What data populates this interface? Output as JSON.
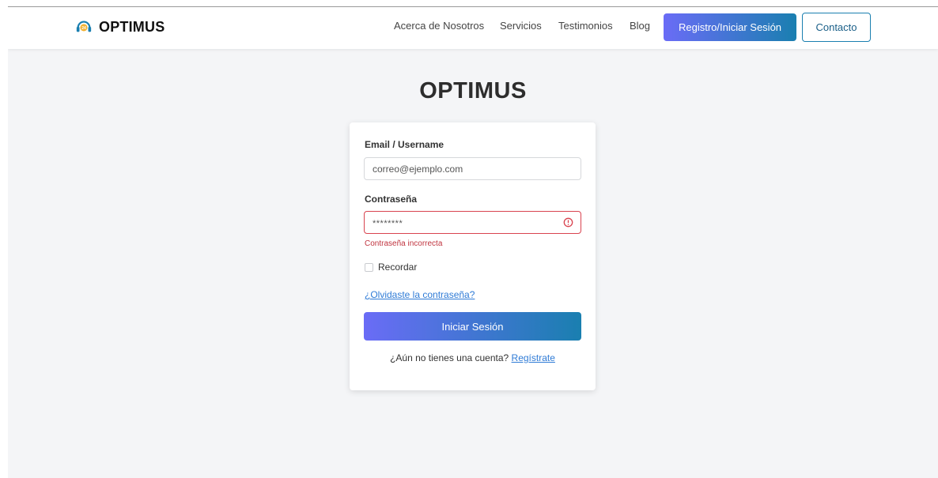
{
  "navbar": {
    "brand": "OPTIMUS",
    "logo_icon": "headset-logo-icon",
    "links": [
      "Acerca de Nosotros",
      "Servicios",
      "Testimonios",
      "Blog"
    ],
    "register_button": "Registro/Iniciar Sesión",
    "contact_button": "Contacto"
  },
  "hero": {
    "title": "OPTIMUS"
  },
  "login": {
    "email_label": "Email / Username",
    "email_value": "correo@ejemplo.com",
    "password_label": "Contraseña",
    "password_value": "********",
    "password_error": "Contraseña incorrecta",
    "remember_label": "Recordar",
    "remember_checked": false,
    "forgot_link": "¿Olvidaste la contraseña?",
    "submit_button": "Iniciar Sesión",
    "signup_prompt": "¿Aún no tienes una cuenta?",
    "signup_link": "Regístrate"
  },
  "colors": {
    "gradient_start": "#6a6cf6",
    "gradient_end": "#1a7fb0",
    "error": "#d9434f",
    "link": "#2f7bd6"
  }
}
